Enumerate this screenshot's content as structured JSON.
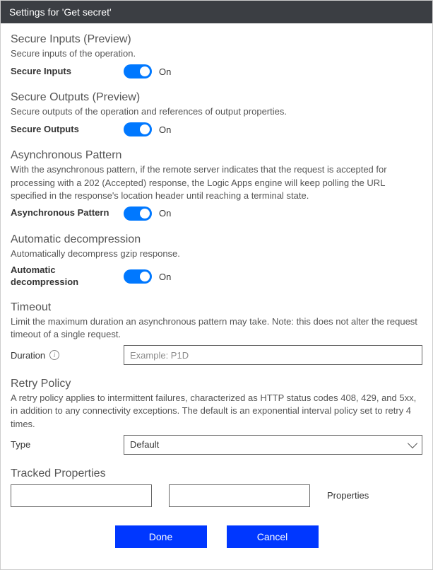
{
  "header": {
    "title": "Settings for 'Get secret'"
  },
  "sections": {
    "secureInputs": {
      "title": "Secure Inputs (Preview)",
      "desc": "Secure inputs of the operation.",
      "toggleLabel": "Secure Inputs",
      "state": "On"
    },
    "secureOutputs": {
      "title": "Secure Outputs (Preview)",
      "desc": "Secure outputs of the operation and references of output properties.",
      "toggleLabel": "Secure Outputs",
      "state": "On"
    },
    "asyncPattern": {
      "title": "Asynchronous Pattern",
      "desc": "With the asynchronous pattern, if the remote server indicates that the request is accepted for processing with a 202 (Accepted) response, the Logic Apps engine will keep polling the URL specified in the response's location header until reaching a terminal state.",
      "toggleLabel": "Asynchronous Pattern",
      "state": "On"
    },
    "autoDecompress": {
      "title": "Automatic decompression",
      "desc": "Automatically decompress gzip response.",
      "toggleLabel": "Automatic decompression",
      "state": "On"
    },
    "timeout": {
      "title": "Timeout",
      "desc": "Limit the maximum duration an asynchronous pattern may take. Note: this does not alter the request timeout of a single request.",
      "fieldLabel": "Duration",
      "placeholder": "Example: P1D"
    },
    "retry": {
      "title": "Retry Policy",
      "desc": "A retry policy applies to intermittent failures, characterized as HTTP status codes 408, 429, and 5xx, in addition to any connectivity exceptions. The default is an exponential interval policy set to retry 4 times.",
      "fieldLabel": "Type",
      "value": "Default"
    },
    "tracked": {
      "title": "Tracked Properties",
      "caption": "Properties"
    }
  },
  "footer": {
    "done": "Done",
    "cancel": "Cancel"
  }
}
